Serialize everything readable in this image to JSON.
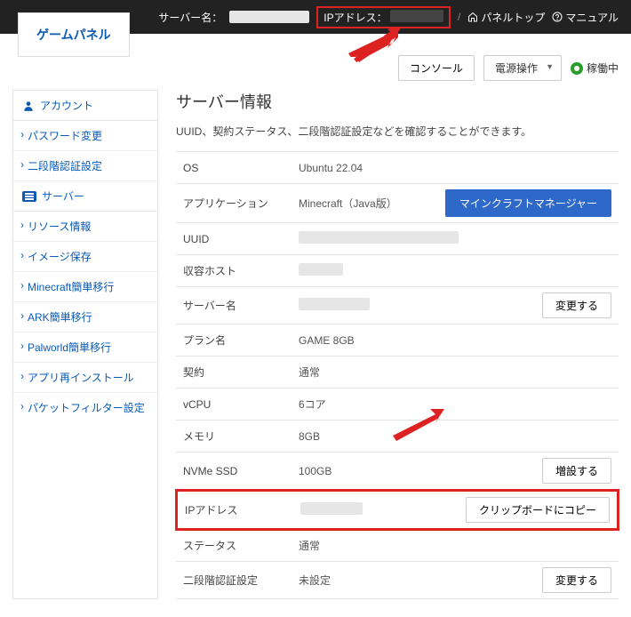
{
  "header": {
    "logo": "ゲームパネル",
    "server_name_label": "サーバー名：",
    "server_name_value": "　　　　　",
    "ip_label": "IPアドレス：",
    "ip_value": "　　　　　",
    "panel_top": "パネルトップ",
    "manual": "マニュアル"
  },
  "toolbar": {
    "console": "コンソール",
    "power": "電源操作",
    "status": "稼働中"
  },
  "sidebar": {
    "account_head": "アカウント",
    "account_items": [
      "パスワード変更",
      "二段階認証設定"
    ],
    "server_head": "サーバー",
    "server_items": [
      "リソース情報",
      "イメージ保存",
      "Minecraft簡単移行",
      "ARK簡単移行",
      "Palworld簡単移行",
      "アプリ再インストール",
      "パケットフィルター設定"
    ]
  },
  "main": {
    "title": "サーバー情報",
    "desc": "UUID、契約ステータス、二段階認証設定などを確認することができます。",
    "rows": {
      "os_label": "OS",
      "os_value": "Ubuntu 22.04",
      "app_label": "アプリケーション",
      "app_value": "Minecraft（Java版）",
      "app_button": "マインクラフトマネージャー",
      "uuid_label": "UUID",
      "host_label": "収容ホスト",
      "name_label": "サーバー名",
      "name_button": "変更する",
      "plan_label": "プラン名",
      "plan_value": "GAME 8GB",
      "contract_label": "契約",
      "contract_value": "通常",
      "vcpu_label": "vCPU",
      "vcpu_value": "6コア",
      "mem_label": "メモリ",
      "mem_value": "8GB",
      "ssd_label": "NVMe SSD",
      "ssd_value": "100GB",
      "ssd_button": "増設する",
      "ip_label": "IPアドレス",
      "ip_button": "クリップボードにコピー",
      "status_label": "ステータス",
      "status_value": "通常",
      "mfa_label": "二段階認証設定",
      "mfa_value": "未設定",
      "mfa_button": "変更する"
    }
  }
}
